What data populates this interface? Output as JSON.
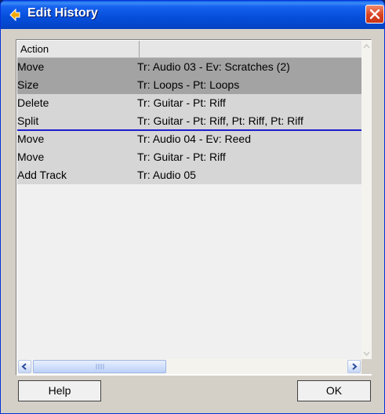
{
  "window": {
    "title": "Edit History",
    "close_glyph": "×"
  },
  "table": {
    "columns": [
      "Action",
      ""
    ],
    "rows": [
      {
        "action": "Move",
        "details": "Tr: Audio 03 - Ev: Scratches (2)",
        "state": "done"
      },
      {
        "action": "Size",
        "details": "Tr: Loops - Pt: Loops",
        "state": "done"
      },
      {
        "action": "Delete",
        "details": "Tr: Guitar - Pt: Riff",
        "state": "undone"
      },
      {
        "action": "Split",
        "details": "Tr: Guitar - Pt: Riff, Pt: Riff, Pt: Riff",
        "state": "undone"
      },
      {
        "action": "Move",
        "details": "Tr: Audio 04 - Ev: Reed",
        "state": "undone"
      },
      {
        "action": "Move",
        "details": "Tr: Guitar - Pt: Riff",
        "state": "undone"
      },
      {
        "action": "Add Track",
        "details": "Tr: Audio 05",
        "state": "undone"
      }
    ]
  },
  "buttons": {
    "help": "Help",
    "ok": "OK"
  },
  "colors": {
    "done_row": "#a3a3a3",
    "undone_row": "#d6d6d6",
    "marker": "#1e1ed0",
    "titlebar": "#0650dc",
    "close": "#d9421f"
  },
  "icons": {
    "app": "cubase-arrow-icon",
    "close": "close-icon"
  }
}
